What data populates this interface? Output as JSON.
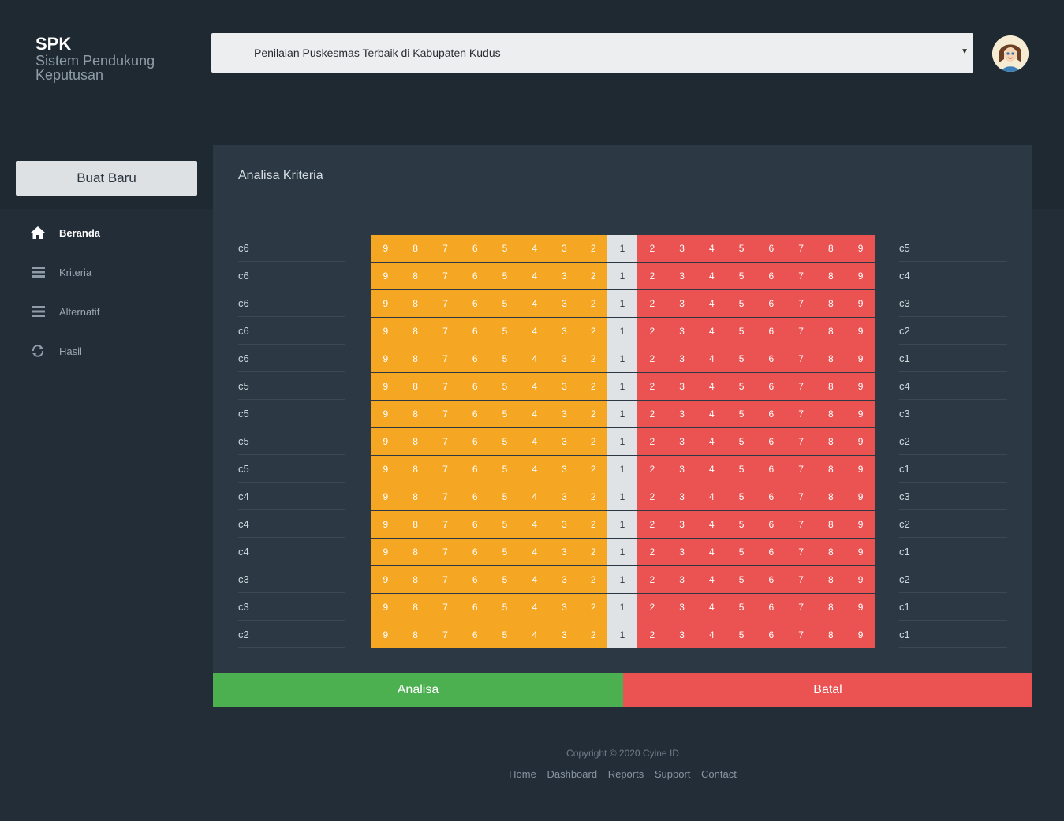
{
  "brand": {
    "title": "SPK",
    "subtitle": "Sistem Pendukung Keputusan"
  },
  "header": {
    "project_selected": "Penilaian Puskesmas Terbaik di Kabupaten Kudus"
  },
  "sidebar": {
    "new_button": "Buat Baru",
    "items": [
      {
        "label": "Beranda",
        "icon": "home-icon",
        "active": true
      },
      {
        "label": "Kriteria",
        "icon": "list-icon",
        "active": false
      },
      {
        "label": "Alternatif",
        "icon": "list-icon",
        "active": false
      },
      {
        "label": "Hasil",
        "icon": "refresh-icon",
        "active": false
      }
    ]
  },
  "panel": {
    "title": "Analisa Kriteria",
    "scale_left": [
      "9",
      "8",
      "7",
      "6",
      "5",
      "4",
      "3",
      "2"
    ],
    "scale_mid": "1",
    "scale_right": [
      "2",
      "3",
      "4",
      "5",
      "6",
      "7",
      "8",
      "9"
    ],
    "comparisons": [
      {
        "left": "c6",
        "right": "c5"
      },
      {
        "left": "c6",
        "right": "c4"
      },
      {
        "left": "c6",
        "right": "c3"
      },
      {
        "left": "c6",
        "right": "c2"
      },
      {
        "left": "c6",
        "right": "c1"
      },
      {
        "left": "c5",
        "right": "c4"
      },
      {
        "left": "c5",
        "right": "c3"
      },
      {
        "left": "c5",
        "right": "c2"
      },
      {
        "left": "c5",
        "right": "c1"
      },
      {
        "left": "c4",
        "right": "c3"
      },
      {
        "left": "c4",
        "right": "c2"
      },
      {
        "left": "c4",
        "right": "c1"
      },
      {
        "left": "c3",
        "right": "c2"
      },
      {
        "left": "c3",
        "right": "c1"
      },
      {
        "left": "c2",
        "right": "c1"
      }
    ]
  },
  "actions": {
    "analyze": "Analisa",
    "cancel": "Batal"
  },
  "footer": {
    "copyright": "Copyright © 2020 Cyine ID",
    "links": [
      "Home",
      "Dashboard",
      "Reports",
      "Support",
      "Contact"
    ]
  },
  "colors": {
    "left_scale": "#f5a623",
    "mid_scale": "#dfe3e6",
    "right_scale": "#eb5252",
    "analyze_button": "#4caf50",
    "cancel_button": "#eb5252"
  }
}
